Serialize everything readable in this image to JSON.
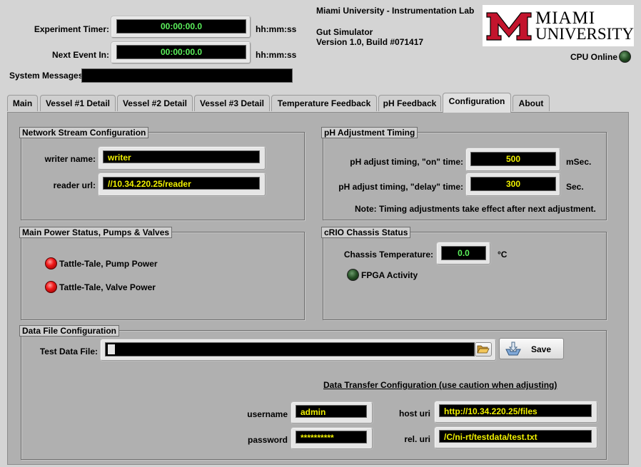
{
  "header": {
    "experiment_timer_label": "Experiment Timer:",
    "experiment_timer_value": "00:00:00.0",
    "experiment_timer_unit": "hh:mm:ss",
    "next_event_label": "Next Event In:",
    "next_event_value": "00:00:00.0",
    "next_event_unit": "hh:mm:ss",
    "system_messages_label": "System Messages",
    "system_messages_value": "",
    "lab_name": "Miami University - Instrumentation Lab",
    "app_name": "Gut Simulator",
    "version": "Version 1.0, Build #071417",
    "cpu_label": "CPU Online",
    "logo_line1": "MIAMI",
    "logo_line2": "UNIVERSITY"
  },
  "tabs": [
    {
      "label": "Main"
    },
    {
      "label": "Vessel #1 Detail"
    },
    {
      "label": "Vessel #2 Detail"
    },
    {
      "label": "Vessel #3 Detail"
    },
    {
      "label": "Temperature Feedback"
    },
    {
      "label": "pH Feedback"
    },
    {
      "label": "Configuration"
    },
    {
      "label": "About"
    }
  ],
  "network": {
    "title": "Network Stream Configuration",
    "writer_label": "writer name:",
    "writer_value": "writer",
    "reader_label": "reader url:",
    "reader_value": "//10.34.220.25/reader"
  },
  "ph_timing": {
    "title": "pH Adjustment Timing",
    "on_label": "pH adjust timing, \"on\" time:",
    "on_value": "500",
    "on_unit": "mSec.",
    "delay_label": "pH adjust timing, \"delay\" time:",
    "delay_value": "300",
    "delay_unit": "Sec.",
    "note": "Note: Timing adjustments take effect after next adjustment."
  },
  "power": {
    "title": "Main Power Status, Pumps & Valves",
    "pump_label": "Tattle-Tale, Pump Power",
    "valve_label": "Tattle-Tale, Valve Power"
  },
  "crio": {
    "title": "cRIO Chassis Status",
    "temp_label": "Chassis Temperature:",
    "temp_value": "0.0",
    "temp_unit": "°C",
    "fpga_label": "FPGA Activity"
  },
  "datafile": {
    "title": "Data File Configuration",
    "file_label": "Test Data File:",
    "file_value": "",
    "save_label": "Save",
    "transfer_title": "Data Transfer Configuration (use caution when adjusting)",
    "username_label": "username",
    "username_value": "admin",
    "password_label": "password",
    "password_value": "**********",
    "host_label": "host uri",
    "host_value": "http://10.34.220.25/files",
    "rel_label": "rel. uri",
    "rel_value": "/C/ni-rt/testdata/test.txt"
  },
  "colors": {
    "timer_text": "#5cf25c",
    "value_text": "#f0f000",
    "led_red": "#f01a1a",
    "led_off": "#234d23",
    "logo_red": "#c3142d"
  }
}
